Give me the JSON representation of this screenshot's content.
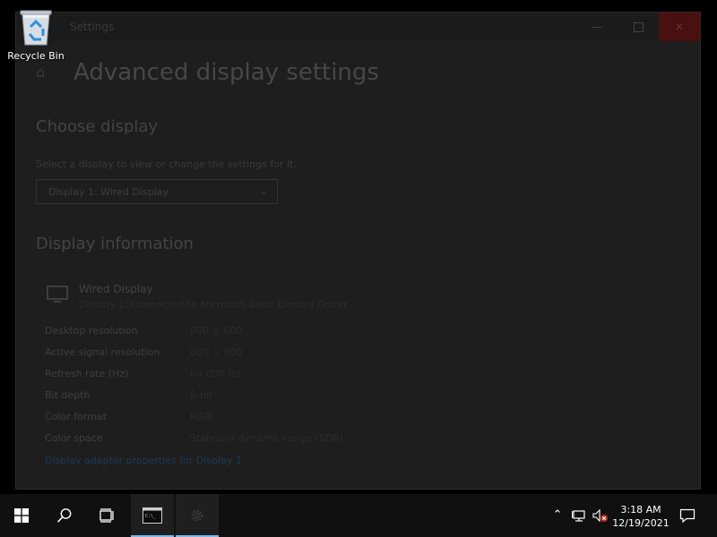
{
  "desktop": {
    "recycle_bin_label": "Recycle Bin"
  },
  "window": {
    "title": "Settings",
    "page_title": "Advanced display settings",
    "choose_display": {
      "heading": "Choose display",
      "subtitle": "Select a display to view or change the settings for it.",
      "selected_display": "Display 1: Wired Display"
    },
    "display_information": {
      "heading": "Display information",
      "monitor_name": "Wired Display",
      "monitor_desc": "Display 1: Connected to Microsoft Basic Display Driver",
      "rows": [
        {
          "label": "Desktop resolution",
          "value": "800 × 600"
        },
        {
          "label": "Active signal resolution",
          "value": "800 × 600"
        },
        {
          "label": "Refresh rate (Hz)",
          "value": "64.000 Hz"
        },
        {
          "label": "Bit depth",
          "value": "8-bit"
        },
        {
          "label": "Color format",
          "value": "RGB"
        },
        {
          "label": "Color space",
          "value": "Standard dynamic range (SDR)"
        }
      ],
      "adapter_link": "Display adapter properties for Display 1"
    }
  },
  "taskbar": {
    "time": "3:18 AM",
    "date": "12/19/2021",
    "icons": [
      "start-icon",
      "search-icon",
      "task-view-icon",
      "terminal-icon",
      "settings-gear-icon"
    ],
    "tray_icons": [
      "chevron-up-icon",
      "network-icon",
      "volume-muted-icon",
      "notification-icon"
    ]
  },
  "colors": {
    "taskbar_bg": "#101010",
    "active_indicator": "#77b9ee",
    "close_button": "#4a1010"
  }
}
